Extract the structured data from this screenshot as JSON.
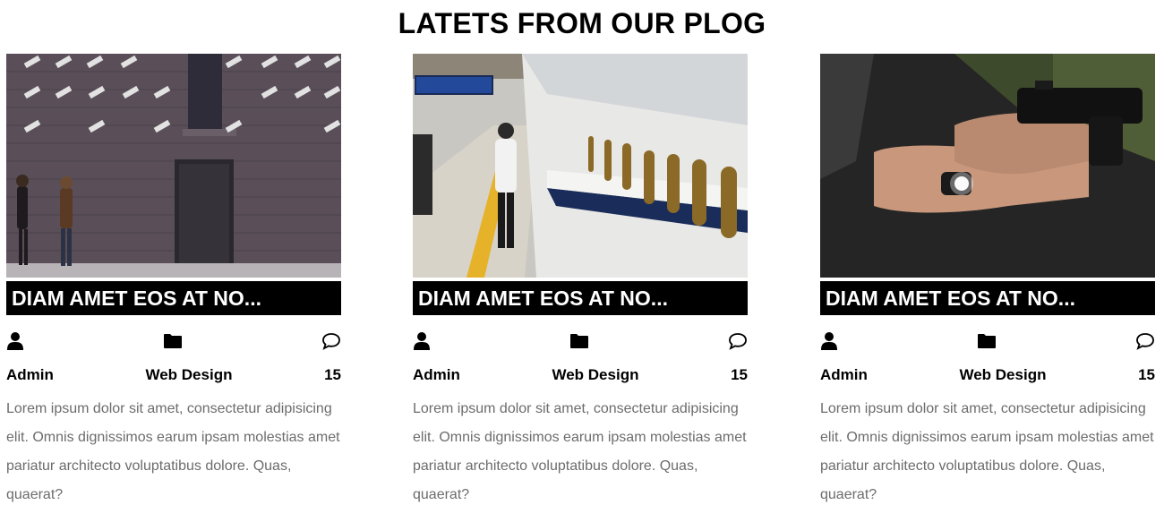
{
  "section": {
    "title": "LATETS FROM OUR PLOG"
  },
  "posts": [
    {
      "image": "photo-surveillance-cameras-wall",
      "title": "DIAM AMET EOS AT NO...",
      "author": "Admin",
      "category": "Web Design",
      "comments": "15",
      "excerpt": "Lorem ipsum dolor sit amet, consectetur adipisicing elit. Omnis dignissimos earum ipsam molestias amet pariatur architecto voluptatibus dolore. Quas, quaerat?"
    },
    {
      "image": "photo-train-station-platform",
      "title": "DIAM AMET EOS AT NO...",
      "author": "Admin",
      "category": "Web Design",
      "comments": "15",
      "excerpt": "Lorem ipsum dolor sit amet, consectetur adipisicing elit. Omnis dignissimos earum ipsam molestias amet pariatur architecto voluptatibus dolore. Quas, quaerat?"
    },
    {
      "image": "photo-handgun-flashlight",
      "title": "DIAM AMET EOS AT NO...",
      "author": "Admin",
      "category": "Web Design",
      "comments": "15",
      "excerpt": "Lorem ipsum dolor sit amet, consectetur adipisicing elit. Omnis dignissimos earum ipsam molestias amet pariatur architecto voluptatibus dolore. Quas, quaerat?"
    }
  ],
  "icons": {
    "author": "user-icon",
    "category": "folder-icon",
    "comments": "comment-icon"
  },
  "colors": {
    "title_bar": "#000000",
    "title_text": "#ffffff",
    "excerpt_text": "#6c6c6c"
  }
}
